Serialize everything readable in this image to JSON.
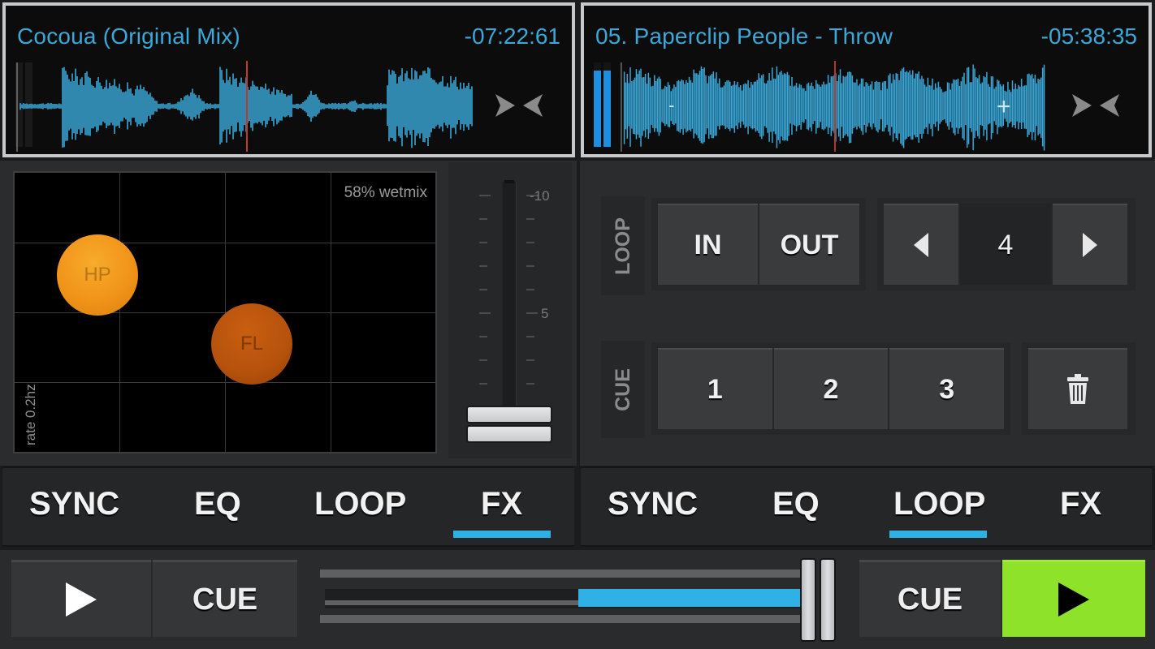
{
  "deck_a": {
    "track_title": "Cocoua (Original Mix)",
    "time_remaining": "-07:22:61",
    "playhead_position": 0.5,
    "waveform_color": "#3aa8d8",
    "playhead_color": "#c0392b",
    "level_meter": 0.0,
    "sync_icon": "nudge-arrows-icon"
  },
  "deck_b": {
    "track_title": "05. Paperclip People - Throw",
    "time_remaining": "-05:38:35",
    "playhead_position": 0.5,
    "waveform_color": "#3aa8d8",
    "playhead_color": "#c0392b",
    "level_meter": 0.9,
    "pitch_minus_label": "-",
    "pitch_plus_label": "+",
    "sync_icon": "nudge-arrows-icon"
  },
  "fx_panel": {
    "wetmix_label": "58% wetmix",
    "rate_label": "rate 0.2hz",
    "effects": [
      {
        "label": "HP",
        "color": "#f09419"
      },
      {
        "label": "FL",
        "color": "#b5520c"
      }
    ],
    "fader": {
      "labels": [
        "-10",
        "5"
      ],
      "value": 0.0
    }
  },
  "loop_panel": {
    "loop_label": "LOOP",
    "in_label": "IN",
    "out_label": "OUT",
    "prev_icon": "triangle-left-icon",
    "loop_length": "4",
    "next_icon": "triangle-right-icon",
    "cue_label": "CUE",
    "cue_buttons": [
      "1",
      "2",
      "3"
    ],
    "delete_icon": "trash-icon"
  },
  "tabs_left": {
    "items": [
      "SYNC",
      "EQ",
      "LOOP",
      "FX"
    ],
    "active": "FX"
  },
  "tabs_right": {
    "items": [
      "SYNC",
      "EQ",
      "LOOP",
      "FX"
    ],
    "active": "LOOP"
  },
  "transport": {
    "left_play_icon": "play-icon",
    "left_cue_label": "CUE",
    "right_cue_label": "CUE",
    "right_play_icon": "play-icon",
    "right_play_color": "#8ee22a",
    "crossfader_position": 0.97,
    "accent_color": "#2fb1e6"
  }
}
